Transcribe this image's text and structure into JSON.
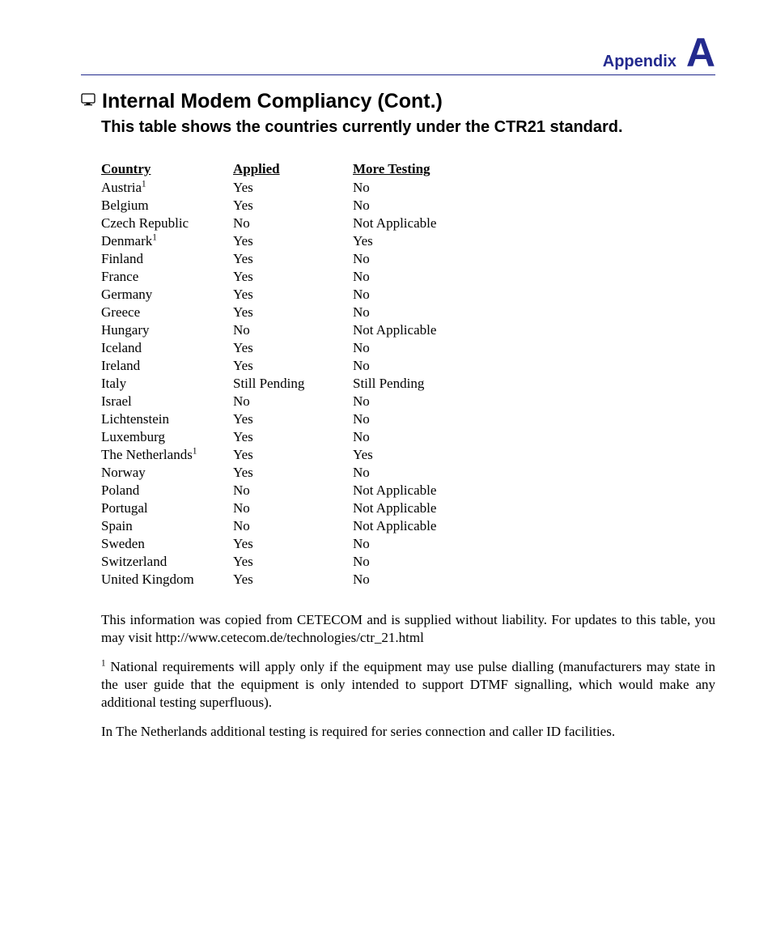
{
  "header": {
    "label": "Appendix",
    "letter": "A"
  },
  "title": "Internal Modem Compliancy (Cont.)",
  "subtitle": "This table shows the countries currently under the CTR21 standard.",
  "table": {
    "headers": {
      "country": "Country",
      "applied": "Applied",
      "more": "More Testing"
    },
    "rows": [
      {
        "country": "Austria",
        "sup": "1",
        "applied": "Yes",
        "more": "No"
      },
      {
        "country": "Belgium",
        "applied": "Yes",
        "more": "No"
      },
      {
        "country": "Czech Republic",
        "applied": "No",
        "more": "Not Applicable"
      },
      {
        "country": "Denmark",
        "sup": "1",
        "applied": "Yes",
        "more": "Yes"
      },
      {
        "country": "Finland",
        "applied": "Yes",
        "more": "No"
      },
      {
        "country": "France",
        "applied": "Yes",
        "more": "No"
      },
      {
        "country": "Germany",
        "applied": "Yes",
        "more": "No"
      },
      {
        "country": "Greece",
        "applied": "Yes",
        "more": "No"
      },
      {
        "country": "Hungary",
        "applied": "No",
        "more": "Not Applicable"
      },
      {
        "country": "Iceland",
        "applied": "Yes",
        "more": "No"
      },
      {
        "country": "Ireland",
        "applied": "Yes",
        "more": "No"
      },
      {
        "country": "Italy",
        "applied": "Still Pending",
        "more": "Still Pending"
      },
      {
        "country": "Israel",
        "applied": "No",
        "more": "No"
      },
      {
        "country": "Lichtenstein",
        "applied": "Yes",
        "more": "No"
      },
      {
        "country": "Luxemburg",
        "applied": "Yes",
        "more": "No"
      },
      {
        "country": "The Netherlands",
        "sup": "1",
        "applied": "Yes",
        "more": "Yes"
      },
      {
        "country": "Norway",
        "applied": "Yes",
        "more": "No"
      },
      {
        "country": "Poland",
        "applied": "No",
        "more": "Not Applicable"
      },
      {
        "country": "Portugal",
        "applied": "No",
        "more": "Not Applicable"
      },
      {
        "country": "Spain",
        "applied": "No",
        "more": "Not Applicable"
      },
      {
        "country": "Sweden",
        "applied": "Yes",
        "more": "No"
      },
      {
        "country": "Switzerland",
        "applied": "Yes",
        "more": "No"
      },
      {
        "country": "United Kingdom",
        "applied": "Yes",
        "more": "No"
      }
    ]
  },
  "paragraphs": {
    "p1": "This information was copied from CETECOM and is supplied without liability. For updates to this table, you may visit http://www.cetecom.de/technologies/ctr_21.html",
    "p2_sup": "1",
    "p2": " National requirements will apply only if the equipment may use pulse dialling (manufacturers may state in the user guide that the equipment is only intended to support DTMF signalling, which would make any additional testing superfluous).",
    "p3": "In The Netherlands additional testing is required for series connection and caller ID facilities."
  }
}
